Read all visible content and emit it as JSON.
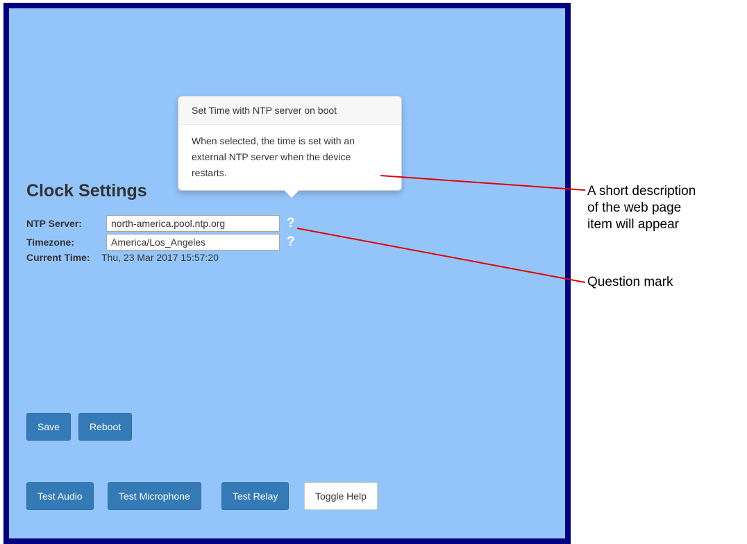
{
  "page": {
    "heading": "Clock Settings"
  },
  "fields": {
    "ntp_server": {
      "label": "NTP Server:",
      "value": "north-america.pool.ntp.org",
      "help": "?"
    },
    "timezone": {
      "label": "Timezone:",
      "value": "America/Los_Angeles",
      "help": "?"
    },
    "current_time": {
      "label": "Current Time:",
      "value": "Thu, 23 Mar 2017 15:57:20"
    }
  },
  "buttons": {
    "save": "Save",
    "reboot": "Reboot",
    "test_audio": "Test Audio",
    "test_microphone": "Test Microphone",
    "test_relay": "Test Relay",
    "toggle_help": "Toggle Help"
  },
  "popover": {
    "title": "Set Time with NTP server on boot",
    "content": "When selected, the time is set with an external NTP server when the device restarts."
  },
  "annotations": {
    "description_callout": [
      "A short description",
      "of the web page",
      "item will appear"
    ],
    "question_mark_callout": "Question mark",
    "leader_color": "#e00000"
  },
  "colors": {
    "panel_background": "#94c5fa",
    "frame_border": "#000080",
    "primary_button": "#337ab7"
  }
}
